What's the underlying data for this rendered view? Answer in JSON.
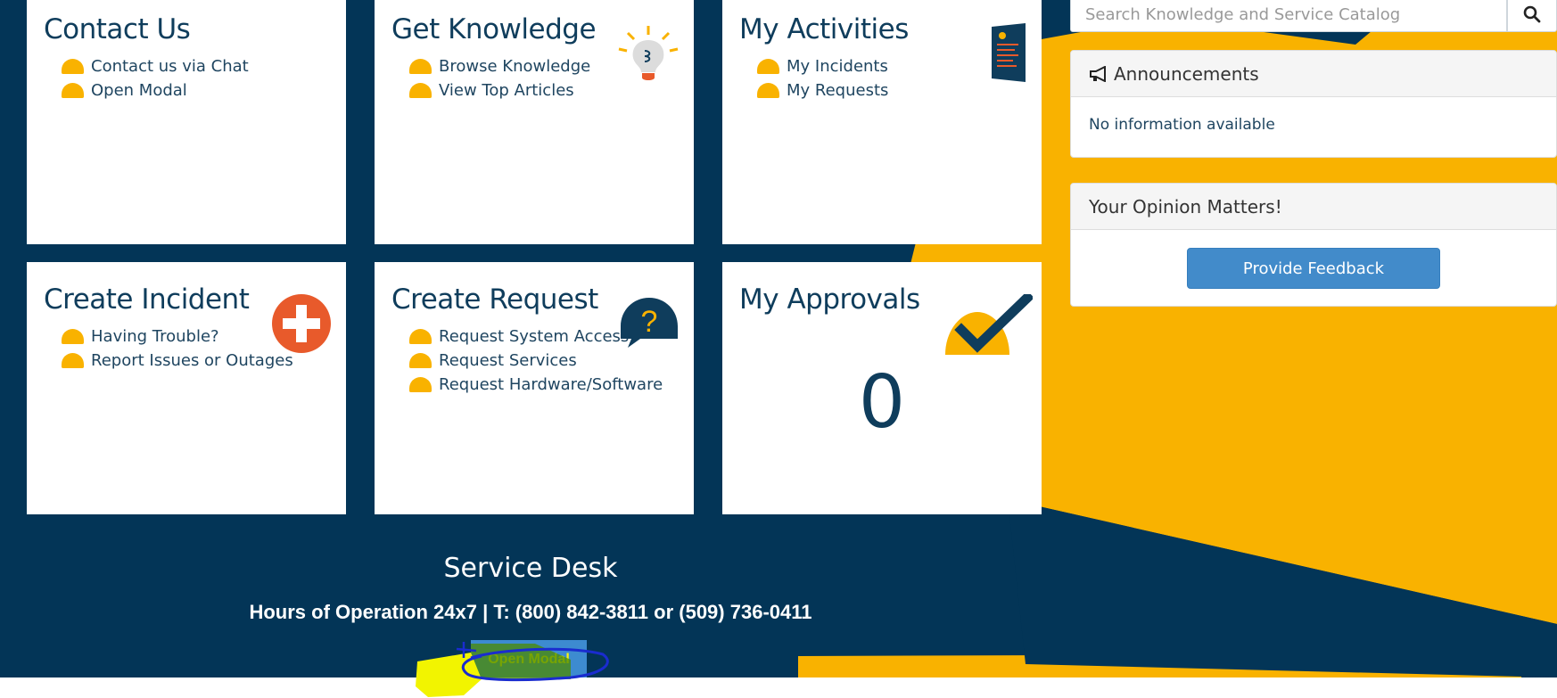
{
  "search": {
    "placeholder": "Search Knowledge and Service Catalog",
    "icon": "search-icon"
  },
  "tiles": {
    "contact": {
      "title": "Contact Us",
      "links": [
        "Contact us via Chat",
        "Open Modal"
      ]
    },
    "knowledge": {
      "title": "Get Knowledge",
      "links": [
        "Browse Knowledge",
        "View Top Articles"
      ],
      "icon": "lightbulb-icon"
    },
    "activities": {
      "title": "My Activities",
      "links": [
        "My Incidents",
        "My Requests"
      ],
      "icon": "document-icon"
    },
    "incident": {
      "title": "Create Incident",
      "links": [
        "Having Trouble?",
        "Report Issues or Outages"
      ],
      "icon": "plus-circle-icon"
    },
    "request": {
      "title": "Create Request",
      "links": [
        "Request System Access",
        "Request Services",
        "Request Hardware/Software"
      ],
      "icon": "question-bubble-icon"
    },
    "approvals": {
      "title": "My Approvals",
      "count": "0",
      "icon": "checkmark-icon"
    }
  },
  "announcements": {
    "title": "Announcements",
    "body": "No information available",
    "icon": "megaphone-icon"
  },
  "opinion": {
    "title": "Your Opinion Matters!",
    "button": "Provide Feedback"
  },
  "footer": {
    "title": "Service Desk",
    "hours": "Hours of Operation 24x7 | T: (800) 842-3811 or (509) 736-0411",
    "button": "Open Modal"
  },
  "colors": {
    "navy": "#033557",
    "accent": "#f9b200",
    "button": "#428bca",
    "orange": "#e85a2b"
  }
}
